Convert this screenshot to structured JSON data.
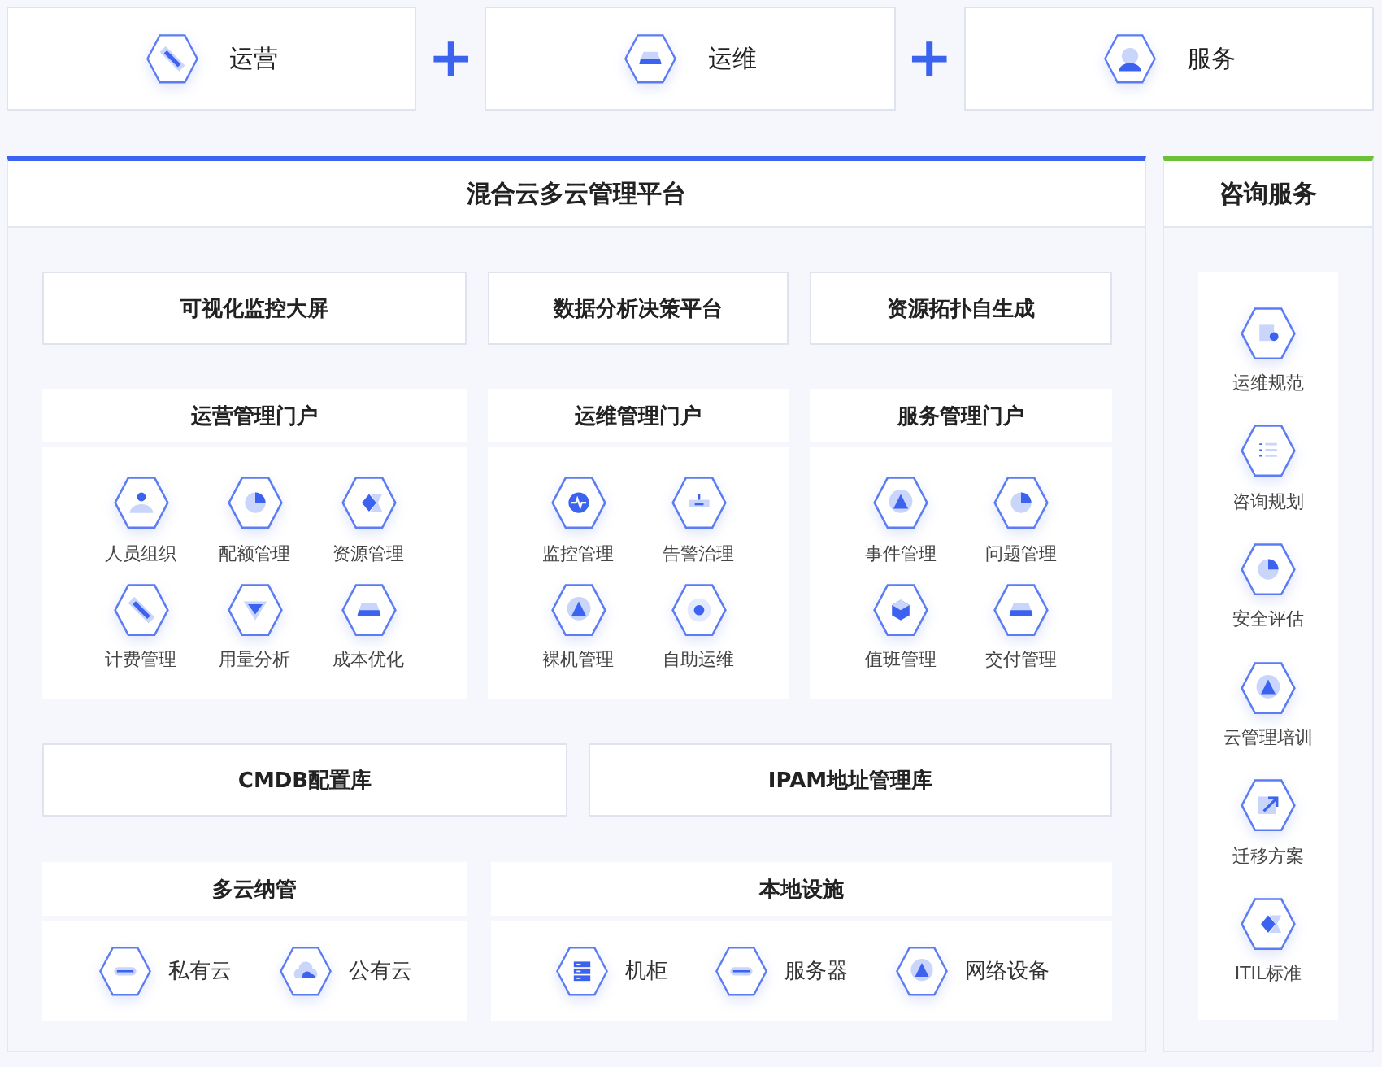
{
  "top_modules": [
    {
      "label": "运营"
    },
    {
      "label": "运维"
    },
    {
      "label": "服务"
    }
  ],
  "connectors": [
    "+",
    "+"
  ],
  "platform": {
    "title": "混合云多云管理平台",
    "tools": [
      "可视化监控大屏",
      "数据分析决策平台",
      "资源拓扑自生成"
    ],
    "portals": [
      {
        "title": "运营管理门户",
        "items": [
          "人员组织",
          "配额管理",
          "资源管理",
          "计费管理",
          "用量分析",
          "成本优化"
        ]
      },
      {
        "title": "运维管理门户",
        "items": [
          "监控管理",
          "告警治理",
          "裸机管理",
          "自助运维"
        ]
      },
      {
        "title": "服务管理门户",
        "items": [
          "事件管理",
          "问题管理",
          "值班管理",
          "交付管理"
        ]
      }
    ],
    "databases": [
      "CMDB配置库",
      "IPAM地址管理库"
    ],
    "infrastructure": [
      {
        "title": "多云纳管",
        "items": [
          "私有云",
          "公有云"
        ]
      },
      {
        "title": "本地设施",
        "items": [
          "机柜",
          "服务器",
          "网络设备"
        ]
      }
    ]
  },
  "consulting": {
    "title": "咨询服务",
    "items": [
      "运维规范",
      "咨询规划",
      "安全评估",
      "云管理培训",
      "迁移方案",
      "ITIL标准"
    ]
  }
}
